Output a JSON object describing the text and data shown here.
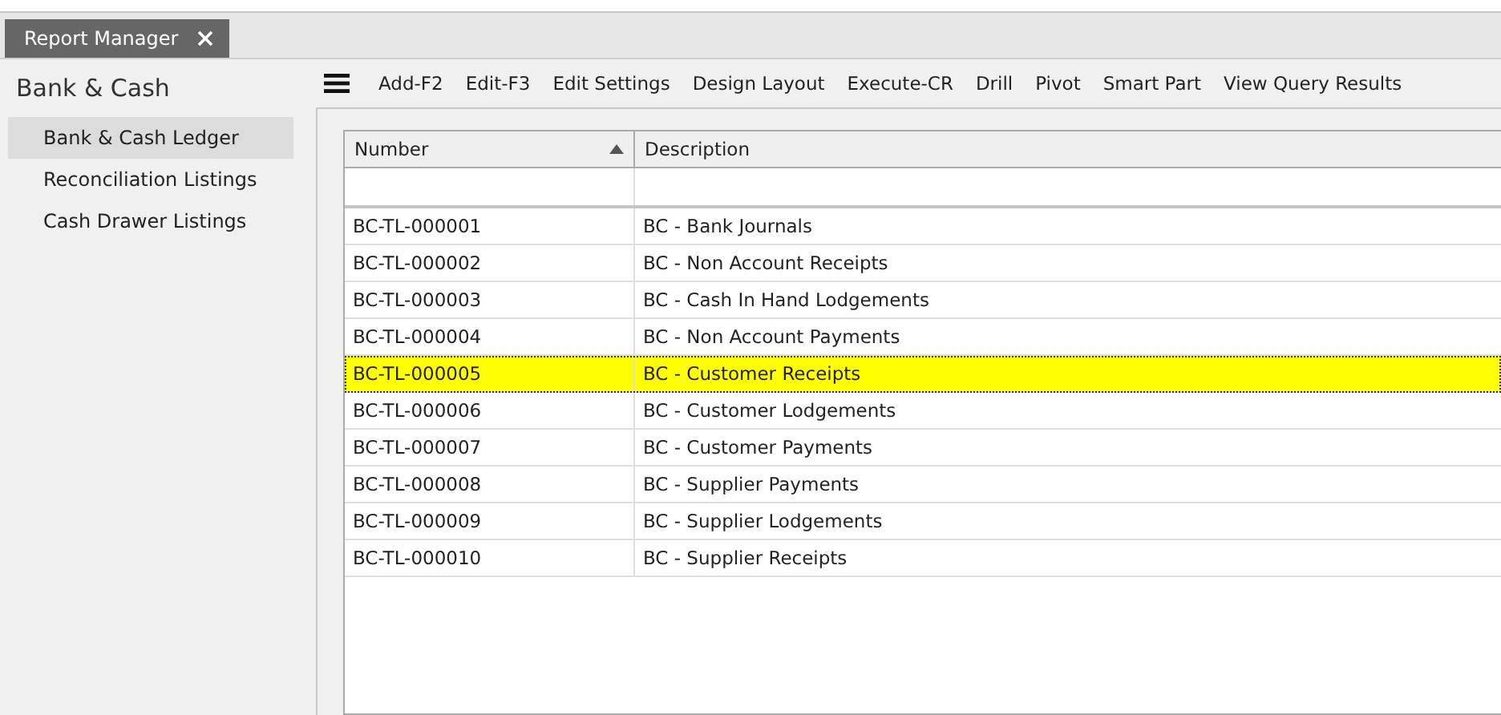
{
  "tabs": [
    {
      "label": "Report Manager",
      "selected": true
    }
  ],
  "sidebar": {
    "title": "Bank & Cash",
    "items": [
      {
        "label": "Bank & Cash Ledger",
        "selected": true
      },
      {
        "label": "Reconciliation Listings",
        "selected": false
      },
      {
        "label": "Cash Drawer Listings",
        "selected": false
      }
    ]
  },
  "toolbar": {
    "items": [
      "Add-F2",
      "Edit-F3",
      "Edit Settings",
      "Design Layout",
      "Execute-CR",
      "Drill",
      "Pivot",
      "Smart Part",
      "View Query Results"
    ]
  },
  "table": {
    "columns": [
      {
        "label": "Number",
        "sorted": true
      },
      {
        "label": "Description",
        "sorted": false
      }
    ],
    "rows": [
      {
        "number": "BC-TL-000001",
        "description": "BC - Bank Journals",
        "selected": false
      },
      {
        "number": "BC-TL-000002",
        "description": "BC - Non Account Receipts",
        "selected": false
      },
      {
        "number": "BC-TL-000003",
        "description": "BC - Cash In Hand Lodgements",
        "selected": false
      },
      {
        "number": "BC-TL-000004",
        "description": "BC - Non Account Payments",
        "selected": false
      },
      {
        "number": "BC-TL-000005",
        "description": "BC - Customer Receipts",
        "selected": true
      },
      {
        "number": "BC-TL-000006",
        "description": "BC - Customer Lodgements",
        "selected": false
      },
      {
        "number": "BC-TL-000007",
        "description": "BC - Customer Payments",
        "selected": false
      },
      {
        "number": "BC-TL-000008",
        "description": "BC - Supplier Payments",
        "selected": false
      },
      {
        "number": "BC-TL-000009",
        "description": "BC - Supplier Lodgements",
        "selected": false
      },
      {
        "number": "BC-TL-000010",
        "description": "BC - Supplier Receipts",
        "selected": false
      }
    ]
  }
}
